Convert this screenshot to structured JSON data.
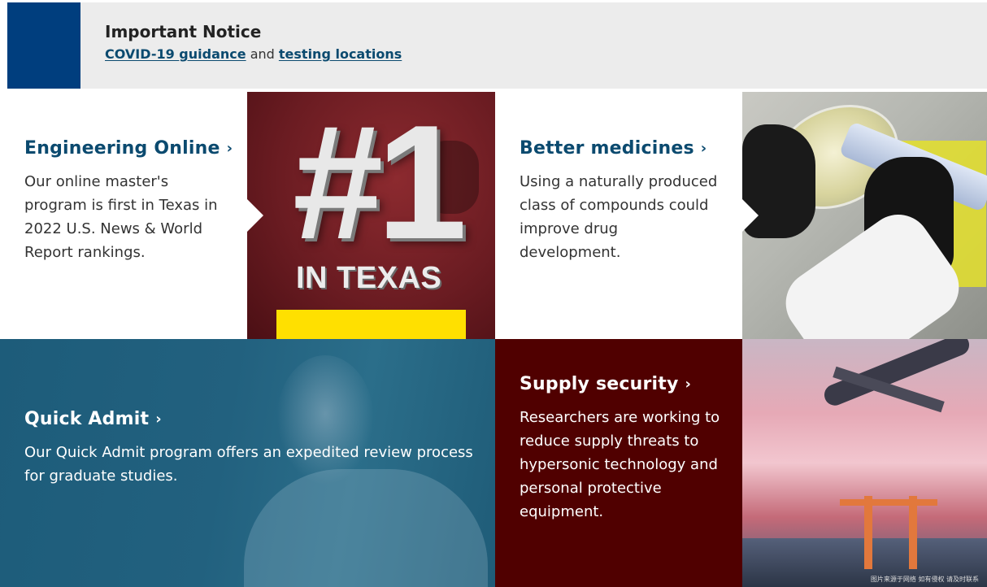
{
  "notice": {
    "title": "Important Notice",
    "link1": "COVID-19 guidance",
    "connector": " and ",
    "link2": "testing locations",
    "accent_color": "#003e7e"
  },
  "tiles": {
    "engineering": {
      "heading": "Engineering Online",
      "chevron": "›",
      "body": "Our online master's program is first in Texas in 2022 U.S. News & World Report rankings."
    },
    "ranking_badge": {
      "big": "#1",
      "caption": "IN TEXAS",
      "bar_color": "#ffe000"
    },
    "medicines": {
      "heading": "Better medicines",
      "chevron": "›",
      "body": "Using a naturally produced class of compounds could improve drug development."
    },
    "quick_admit": {
      "heading": "Quick Admit",
      "chevron": "›",
      "body": "Our Quick Admit program offers an expedited review process for graduate studies."
    },
    "supply": {
      "heading": "Supply security",
      "chevron": "›",
      "body": "Researchers are working to reduce supply threats to hypersonic technology and personal protective equipment.",
      "bg_color": "#500000"
    },
    "airport_image": {
      "caption": "图片来源于网络 如有侵权 请及时联系"
    }
  },
  "colors": {
    "link": "#0b4a6f",
    "maroon": "#500000",
    "teal": "#1d5c7a"
  }
}
